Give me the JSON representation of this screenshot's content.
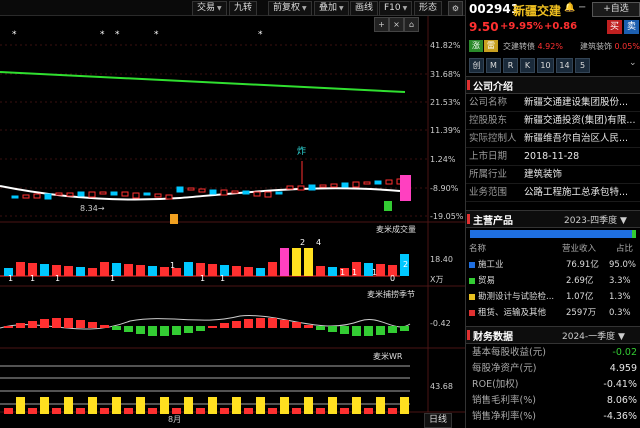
{
  "toolbar": {
    "buttons": [
      "交易",
      "九转",
      "前复权",
      "叠加",
      "画线",
      "F10",
      "形态"
    ],
    "icon_labels": [
      "+",
      "×",
      "⌂"
    ]
  },
  "chart": {
    "y_labels": [
      "41.82%",
      "31.68%",
      "21.53%",
      "11.39%",
      "1.24%",
      "-8.90%",
      "-19.05%"
    ],
    "low_marker": "8.34→",
    "zha_label": "炸",
    "star_marks": [
      "*",
      "*",
      "*",
      "*",
      "*"
    ],
    "volume_pane": {
      "title": "麦米成交量",
      "right_label": "18.40",
      "unit": "X万",
      "counts": [
        "1",
        "1",
        "1",
        "1",
        "1",
        "1",
        "1",
        "4",
        "2",
        "1",
        "1",
        "1",
        "0",
        "2"
      ]
    },
    "macd_pane": {
      "title": "麦米捕捞季节",
      "right_label": "-0.42",
      "arrow_marks": [
        "↑",
        "↑",
        "↑",
        "↑",
        "↑"
      ]
    },
    "wr_pane": {
      "title": "麦米WR",
      "right_label": "43.68"
    },
    "x_label": "8月",
    "period_button": "日线"
  },
  "quote": {
    "code": "002941",
    "name": "新疆交建",
    "self_select": "自选",
    "price": "9.50",
    "change_pct": "+9.95%",
    "change": "+0.86",
    "buy": "买",
    "sell": "卖",
    "badge_up": "涨",
    "badge_alert": "雷",
    "rel_stock": "交建转债",
    "rel_stock_pct": "4.92%",
    "rel_index": "建筑装饰",
    "rel_index_pct": "0.05%",
    "tags": [
      "创",
      "M",
      "R",
      "K",
      "10",
      "14",
      "5"
    ]
  },
  "company": {
    "header": "公司介绍",
    "rows": [
      {
        "k": "公司名称",
        "v": "新疆交通建设集团股份..."
      },
      {
        "k": "控股股东",
        "v": "新疆交通投资(集团)有限..."
      },
      {
        "k": "实际控制人",
        "v": "新疆维吾尔自治区人民..."
      },
      {
        "k": "上市日期",
        "v": "2018-11-28"
      },
      {
        "k": "所属行业",
        "v": "建筑装饰"
      },
      {
        "k": "业务范围",
        "v": "公路工程施工总承包特..."
      }
    ]
  },
  "products": {
    "header": "主营产品",
    "period": "2023-四季度",
    "col_name": "名称",
    "col_rev": "营业收入",
    "col_pct": "占比",
    "rows": [
      {
        "name": "施工业",
        "rev": "76.91亿",
        "pct": "95.0%",
        "color": "#1f6fe0"
      },
      {
        "name": "贸易",
        "rev": "2.69亿",
        "pct": "3.3%",
        "color": "#33cc33"
      },
      {
        "name": "勘测设计与试验检...",
        "rev": "1.07亿",
        "pct": "1.3%",
        "color": "#e8c020"
      },
      {
        "name": "租赁、运输及其他",
        "rev": "2597万",
        "pct": "0.3%",
        "color": "#e03030"
      }
    ]
  },
  "finance": {
    "header": "财务数据",
    "period": "2024-一季度",
    "rows": [
      {
        "k": "基本每股收益(元)",
        "v": "-0.02",
        "color": "#33cc33"
      },
      {
        "k": "每股净资产(元)",
        "v": "4.959",
        "color": "#e6e6e6"
      },
      {
        "k": "ROE(加权)",
        "v": "-0.41%",
        "color": "#e6e6e6"
      },
      {
        "k": "销售毛利率(%)",
        "v": "8.06%",
        "color": "#e6e6e6"
      },
      {
        "k": "销售净利率(%)",
        "v": "-4.36%",
        "color": "#e6e6e6"
      }
    ]
  },
  "colors": {
    "up": "#ff3030",
    "down": "#00c8ff",
    "ma": "#30e030",
    "wr_line": "#ffffff"
  }
}
